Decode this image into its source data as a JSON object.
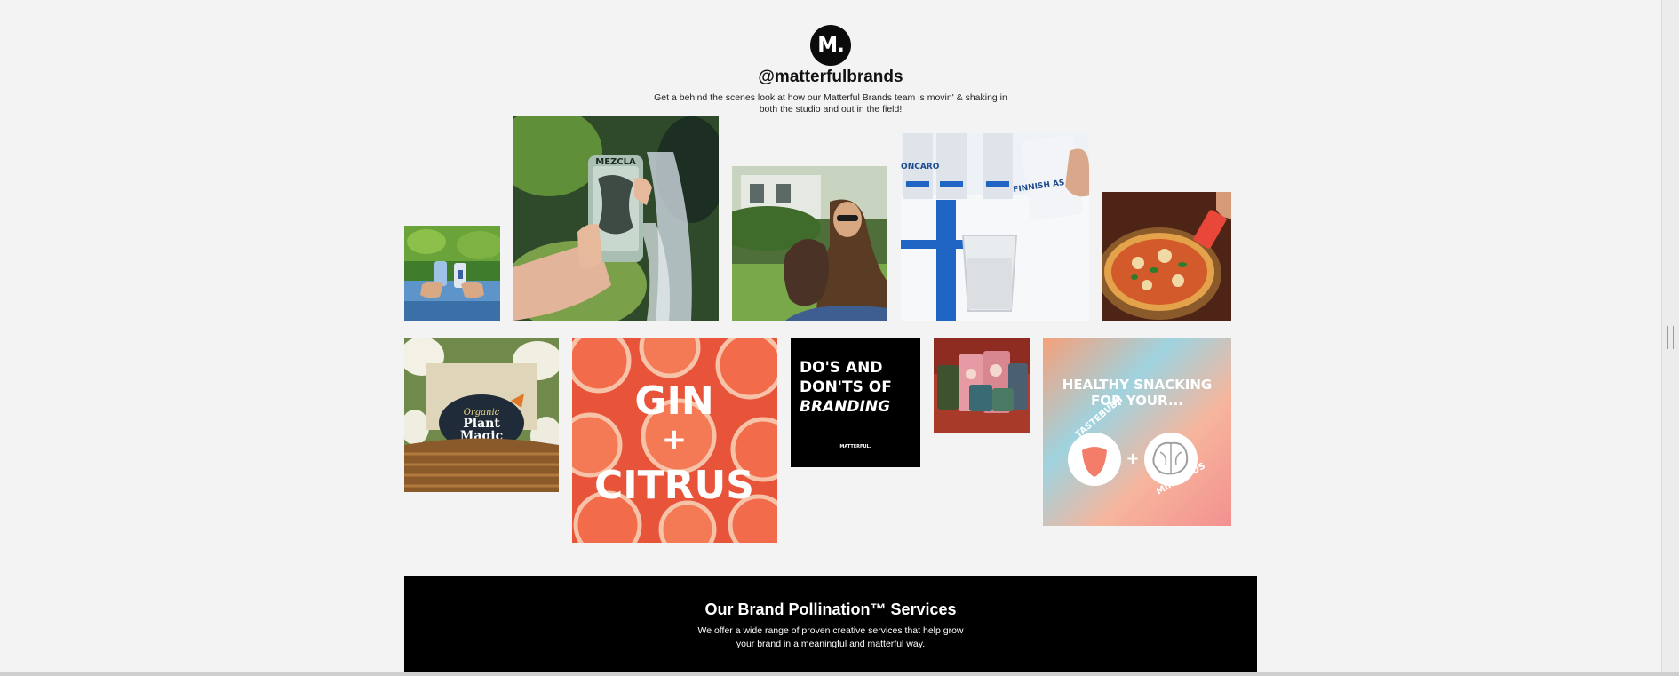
{
  "profile": {
    "logo_text": "M.",
    "handle": "@matterfulbrands",
    "description": "Get a behind the scenes look at how our Matterful Brands team is movin' & shaking in both the studio and out in the field!"
  },
  "gallery": {
    "tiles": [
      {
        "name": "cans-by-water-photo"
      },
      {
        "name": "snack-bar-waterfall-photo",
        "label": "MEZCLA"
      },
      {
        "name": "woman-with-puppy-photo"
      },
      {
        "name": "loncaro-drinks-photo",
        "label_brand": "LONCARO",
        "label_can": "FINNISH AS F*CK"
      },
      {
        "name": "pizza-photo"
      },
      {
        "name": "organic-plant-magic-photo",
        "label_line1": "Organic",
        "label_line2": "Plant",
        "label_line3": "Magic"
      },
      {
        "name": "gin-citrus-graphic",
        "line1": "GIN",
        "line2": "+",
        "line3": "CITRUS"
      },
      {
        "name": "dos-and-donts-graphic",
        "line1": "DO'S AND",
        "line2": "DON'TS OF",
        "line3": "BRANDING",
        "footer": "MATTERFUL."
      },
      {
        "name": "snack-bags-photo"
      },
      {
        "name": "healthy-snacking-graphic",
        "line1": "HEALTHY SNACKING",
        "line2": "FOR YOUR...",
        "left_arc": "TASTEBUDS",
        "plus": "+",
        "right_arc": "MINDBUDS"
      }
    ]
  },
  "services": {
    "title": "Our Brand Pollination™ Services",
    "description": "We offer a wide range of proven creative services that help grow your brand in a meaningful and matterful way."
  }
}
